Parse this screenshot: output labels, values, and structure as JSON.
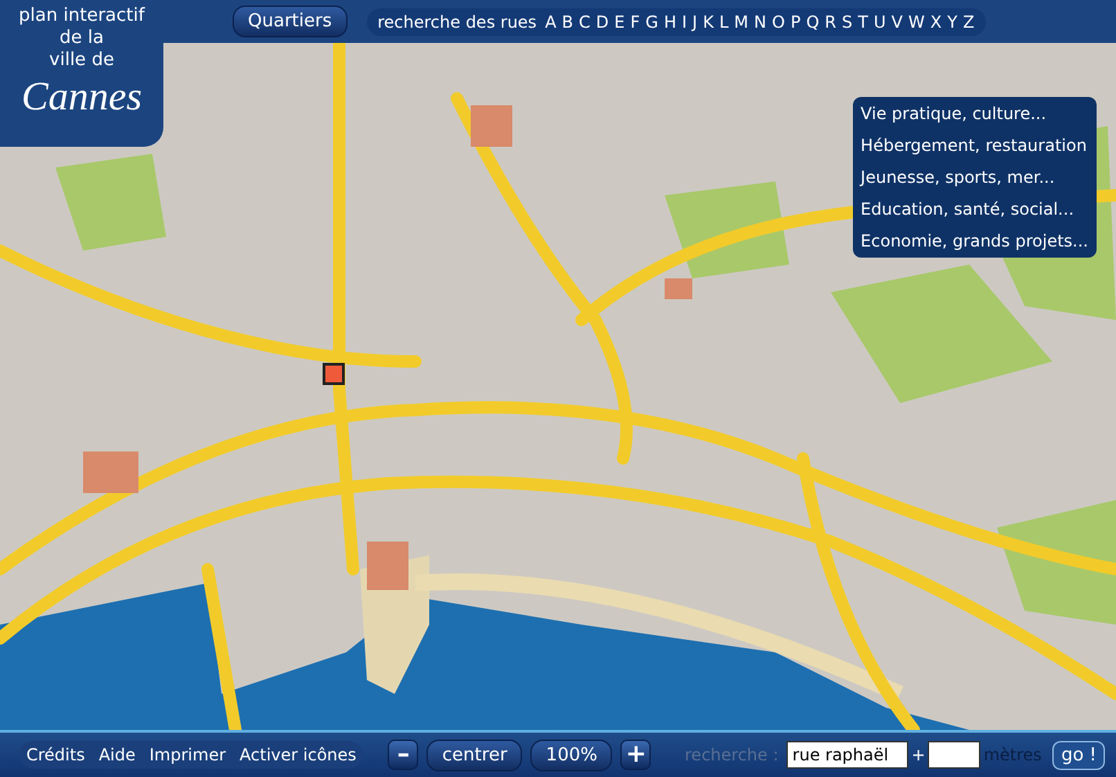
{
  "title": {
    "lines": [
      "plan interactif",
      "de la",
      "ville de"
    ],
    "city": "Cannes"
  },
  "top_bar": {
    "quartiers_button": "Quartiers",
    "street_search_label": "recherche des rues",
    "letters": [
      "A",
      "B",
      "C",
      "D",
      "E",
      "F",
      "G",
      "H",
      "I",
      "J",
      "K",
      "L",
      "M",
      "N",
      "O",
      "P",
      "Q",
      "R",
      "S",
      "T",
      "U",
      "V",
      "W",
      "X",
      "Y",
      "Z"
    ]
  },
  "themes_menu": {
    "items": [
      "Vie pratique, culture...",
      "Hébergement, restauration",
      "Jeunesse, sports, mer...",
      "Education, santé, social...",
      "Economie, grands projets..."
    ]
  },
  "bottom_bar": {
    "buttons": [
      "Crédits",
      "Aide",
      "Imprimer",
      "Activer icônes"
    ],
    "zoom_out": "–",
    "center": "centrer",
    "zoom_level": "100%",
    "zoom_in": "+",
    "search": {
      "label": "recherche :",
      "value": "rue raphaël",
      "separator": "+",
      "distance_unit": "mètres",
      "go": "go !"
    }
  }
}
